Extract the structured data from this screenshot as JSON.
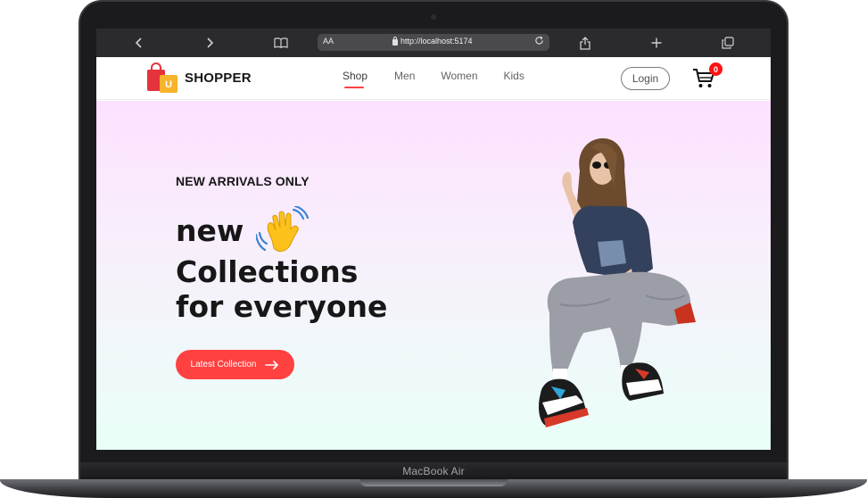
{
  "device": {
    "model_label": "MacBook Air"
  },
  "browser": {
    "text_size_label": "AA",
    "url": "http://localhost:5174",
    "icons": [
      "chevron-left-icon",
      "chevron-right-icon",
      "book-icon",
      "lock-icon",
      "reload-icon",
      "share-icon",
      "plus-icon",
      "tabs-icon"
    ]
  },
  "site": {
    "logo_text": "SHOPPER",
    "logo_bag_letter": "U",
    "nav": [
      {
        "label": "Shop",
        "active": true
      },
      {
        "label": "Men",
        "active": false
      },
      {
        "label": "Women",
        "active": false
      },
      {
        "label": "Kids",
        "active": false
      }
    ],
    "login_label": "Login",
    "cart_count": "0"
  },
  "hero": {
    "tag": "NEW ARRIVALS ONLY",
    "line1": "new",
    "line2": "Collections",
    "line3": "for everyone",
    "cta_label": "Latest Collection"
  },
  "colors": {
    "accent": "#ff4141",
    "badge": "#ff1111",
    "hero_top": "#fde1ff",
    "hero_bottom": "#e9fff8"
  }
}
